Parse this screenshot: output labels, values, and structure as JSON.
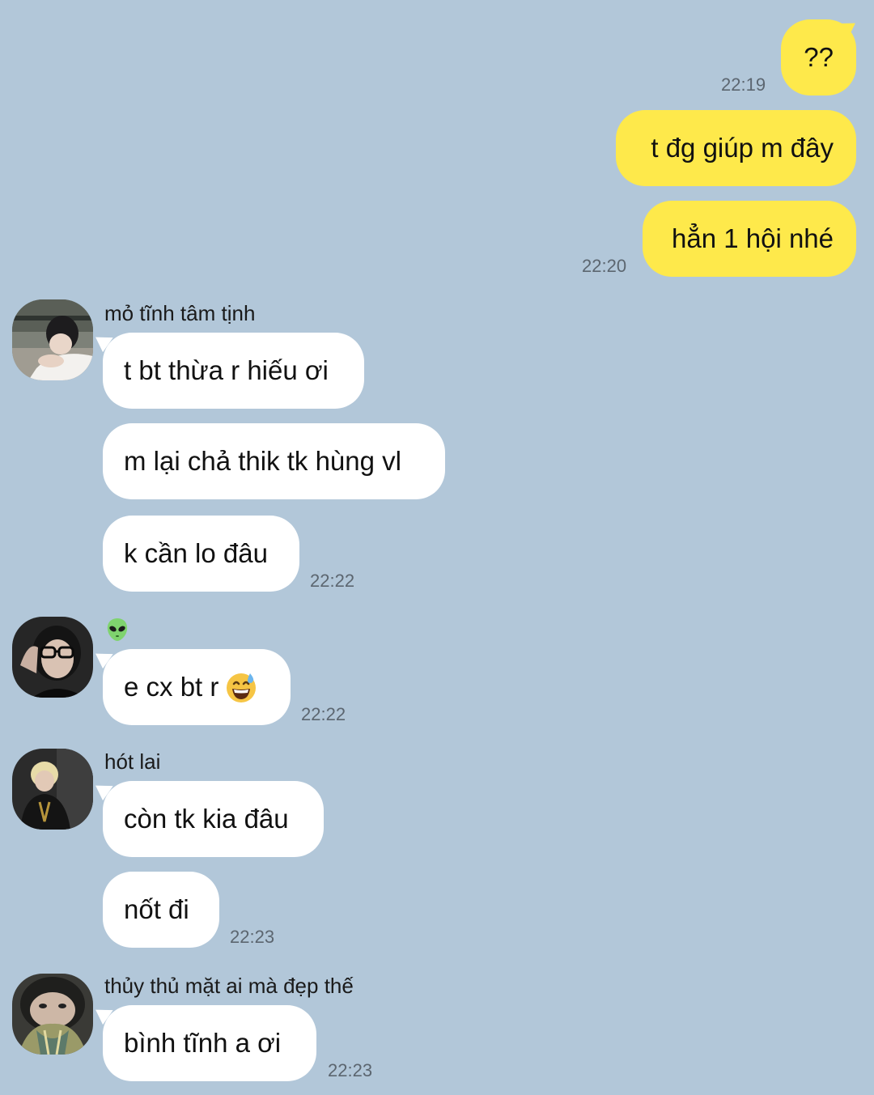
{
  "theme": {
    "background": "#b2c7d9",
    "my_bubble_color": "#fee94b",
    "their_bubble_color": "#ffffff",
    "time_color": "#5c6670"
  },
  "messages_out": [
    {
      "text": "??",
      "time": "22:19"
    },
    {
      "text": "t đg giúp m đây",
      "time": ""
    },
    {
      "text": "hẳn 1 hội nhé",
      "time": "22:20"
    }
  ],
  "groups": [
    {
      "sender": "mỏ tĩnh tâm tịnh",
      "avatar_icon": "profile-photo",
      "messages": [
        {
          "text": "t bt thừa r hiếu ơi",
          "time": ""
        },
        {
          "text": "m lại chả thik tk hùng vl",
          "time": ""
        },
        {
          "text": "k cần lo đâu",
          "time": "22:22"
        }
      ]
    },
    {
      "sender": "",
      "sender_icon": "alien-emoji-icon",
      "avatar_icon": "profile-photo",
      "messages": [
        {
          "text": "e cx bt r",
          "emoji": "grinning-sweat-emoji-icon",
          "time": "22:22"
        }
      ]
    },
    {
      "sender": "hót lai",
      "avatar_icon": "profile-photo",
      "messages": [
        {
          "text": "còn tk kia đâu",
          "time": ""
        },
        {
          "text": "nốt đi",
          "time": "22:23"
        }
      ]
    },
    {
      "sender": "thủy thủ mặt ai mà đẹp thế",
      "avatar_icon": "profile-photo",
      "messages": [
        {
          "text": "bình tĩnh a ơi",
          "time": "22:23"
        }
      ]
    }
  ]
}
